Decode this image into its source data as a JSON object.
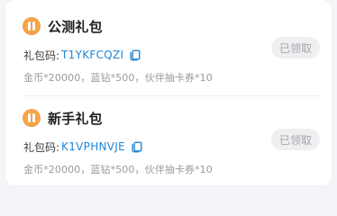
{
  "gifts": [
    {
      "title": "公测礼包",
      "code_label": "礼包码:",
      "code_value": "T1YKFCQZI",
      "rewards": "金币*20000，蓝钻*500，伙伴抽卡券*10",
      "status_label": "已领取"
    },
    {
      "title": "新手礼包",
      "code_label": "礼包码:",
      "code_value": "K1VPHNVJE",
      "rewards": "金币*20000，蓝钻*500，伙伴抽卡券*10",
      "status_label": "已领取"
    }
  ],
  "colors": {
    "accent": "#1f86d6",
    "gift_icon": "#f3a545",
    "muted_text": "#9a9aa0",
    "button_bg": "#efeff1"
  },
  "icons": {
    "gift": "gift-icon",
    "copy": "copy-icon"
  }
}
